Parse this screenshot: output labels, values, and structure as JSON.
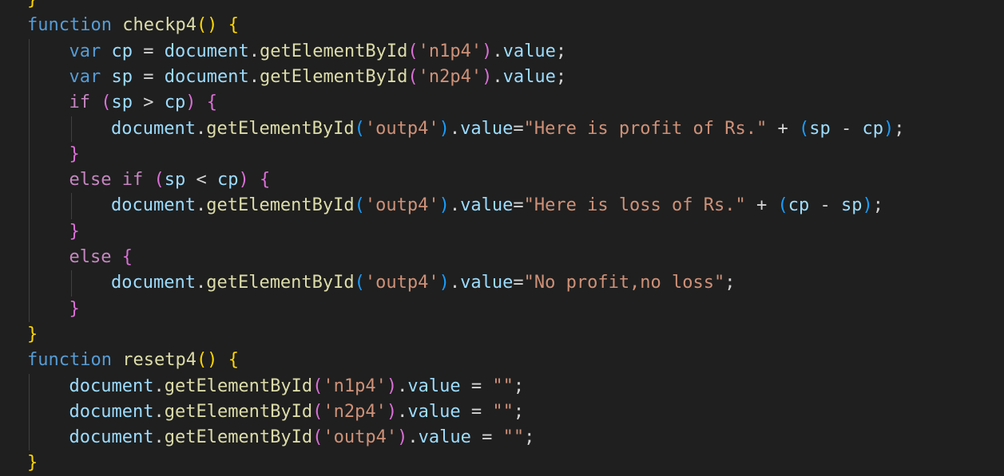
{
  "editor": {
    "background": "#1f1f1f",
    "theme_colors": {
      "keyword": "#569cd6",
      "control": "#c586c0",
      "function": "#dcdcaa",
      "variable": "#9cdcfe",
      "string": "#ce9178",
      "operator": "#d4d4d4",
      "bracket_level_1": "#ffd700",
      "bracket_level_2": "#da70d6",
      "bracket_level_3": "#179fff"
    },
    "lines": [
      {
        "indent": 0,
        "tokens": [
          [
            "b1",
            "}"
          ]
        ]
      },
      {
        "indent": 0,
        "tokens": [
          [
            "kw",
            "function"
          ],
          [
            "op",
            " "
          ],
          [
            "fn",
            "checkp4"
          ],
          [
            "b1",
            "()"
          ],
          [
            "op",
            " "
          ],
          [
            "b1",
            "{"
          ]
        ]
      },
      {
        "indent": 1,
        "tokens": [
          [
            "kw",
            "var"
          ],
          [
            "op",
            " "
          ],
          [
            "var",
            "cp"
          ],
          [
            "op",
            " = "
          ],
          [
            "var",
            "document"
          ],
          [
            "op",
            "."
          ],
          [
            "fn",
            "getElementById"
          ],
          [
            "b2",
            "("
          ],
          [
            "str",
            "'n1p4'"
          ],
          [
            "b2",
            ")"
          ],
          [
            "op",
            "."
          ],
          [
            "var",
            "value"
          ],
          [
            "op",
            ";"
          ]
        ]
      },
      {
        "indent": 1,
        "tokens": [
          [
            "kw",
            "var"
          ],
          [
            "op",
            " "
          ],
          [
            "var",
            "sp"
          ],
          [
            "op",
            " = "
          ],
          [
            "var",
            "document"
          ],
          [
            "op",
            "."
          ],
          [
            "fn",
            "getElementById"
          ],
          [
            "b2",
            "("
          ],
          [
            "str",
            "'n2p4'"
          ],
          [
            "b2",
            ")"
          ],
          [
            "op",
            "."
          ],
          [
            "var",
            "value"
          ],
          [
            "op",
            ";"
          ]
        ]
      },
      {
        "indent": 1,
        "tokens": [
          [
            "ctl",
            "if"
          ],
          [
            "op",
            " "
          ],
          [
            "b2",
            "("
          ],
          [
            "var",
            "sp"
          ],
          [
            "op",
            " > "
          ],
          [
            "var",
            "cp"
          ],
          [
            "b2",
            ")"
          ],
          [
            "op",
            " "
          ],
          [
            "b2",
            "{"
          ]
        ]
      },
      {
        "indent": 2,
        "tokens": [
          [
            "var",
            "document"
          ],
          [
            "op",
            "."
          ],
          [
            "fn",
            "getElementById"
          ],
          [
            "b3",
            "("
          ],
          [
            "str",
            "'outp4'"
          ],
          [
            "b3",
            ")"
          ],
          [
            "op",
            "."
          ],
          [
            "var",
            "value"
          ],
          [
            "op",
            "="
          ],
          [
            "str",
            "\"Here is profit of Rs.\""
          ],
          [
            "op",
            " + "
          ],
          [
            "b3",
            "("
          ],
          [
            "var",
            "sp"
          ],
          [
            "op",
            " - "
          ],
          [
            "var",
            "cp"
          ],
          [
            "b3",
            ")"
          ],
          [
            "op",
            ";"
          ]
        ]
      },
      {
        "indent": 1,
        "tokens": [
          [
            "b2",
            "}"
          ]
        ]
      },
      {
        "indent": 1,
        "tokens": [
          [
            "ctl",
            "else"
          ],
          [
            "op",
            " "
          ],
          [
            "ctl",
            "if"
          ],
          [
            "op",
            " "
          ],
          [
            "b2",
            "("
          ],
          [
            "var",
            "sp"
          ],
          [
            "op",
            " < "
          ],
          [
            "var",
            "cp"
          ],
          [
            "b2",
            ")"
          ],
          [
            "op",
            " "
          ],
          [
            "b2",
            "{"
          ]
        ]
      },
      {
        "indent": 2,
        "tokens": [
          [
            "var",
            "document"
          ],
          [
            "op",
            "."
          ],
          [
            "fn",
            "getElementById"
          ],
          [
            "b3",
            "("
          ],
          [
            "str",
            "'outp4'"
          ],
          [
            "b3",
            ")"
          ],
          [
            "op",
            "."
          ],
          [
            "var",
            "value"
          ],
          [
            "op",
            "="
          ],
          [
            "str",
            "\"Here is loss of Rs.\""
          ],
          [
            "op",
            " + "
          ],
          [
            "b3",
            "("
          ],
          [
            "var",
            "cp"
          ],
          [
            "op",
            " - "
          ],
          [
            "var",
            "sp"
          ],
          [
            "b3",
            ")"
          ],
          [
            "op",
            ";"
          ]
        ]
      },
      {
        "indent": 1,
        "tokens": [
          [
            "b2",
            "}"
          ]
        ]
      },
      {
        "indent": 1,
        "tokens": [
          [
            "ctl",
            "else"
          ],
          [
            "op",
            " "
          ],
          [
            "b2",
            "{"
          ]
        ]
      },
      {
        "indent": 2,
        "tokens": [
          [
            "var",
            "document"
          ],
          [
            "op",
            "."
          ],
          [
            "fn",
            "getElementById"
          ],
          [
            "b3",
            "("
          ],
          [
            "str",
            "'outp4'"
          ],
          [
            "b3",
            ")"
          ],
          [
            "op",
            "."
          ],
          [
            "var",
            "value"
          ],
          [
            "op",
            "="
          ],
          [
            "str",
            "\"No profit,no loss\""
          ],
          [
            "op",
            ";"
          ]
        ]
      },
      {
        "indent": 1,
        "tokens": [
          [
            "b2",
            "}"
          ]
        ]
      },
      {
        "indent": 0,
        "tokens": [
          [
            "b1",
            "}"
          ]
        ]
      },
      {
        "indent": 0,
        "tokens": [
          [
            "kw",
            "function"
          ],
          [
            "op",
            " "
          ],
          [
            "fn",
            "resetp4"
          ],
          [
            "b1",
            "()"
          ],
          [
            "op",
            " "
          ],
          [
            "b1",
            "{"
          ]
        ]
      },
      {
        "indent": 1,
        "tokens": [
          [
            "var",
            "document"
          ],
          [
            "op",
            "."
          ],
          [
            "fn",
            "getElementById"
          ],
          [
            "b2",
            "("
          ],
          [
            "str",
            "'n1p4'"
          ],
          [
            "b2",
            ")"
          ],
          [
            "op",
            "."
          ],
          [
            "var",
            "value"
          ],
          [
            "op",
            " = "
          ],
          [
            "str",
            "\"\""
          ],
          [
            "op",
            ";"
          ]
        ]
      },
      {
        "indent": 1,
        "tokens": [
          [
            "var",
            "document"
          ],
          [
            "op",
            "."
          ],
          [
            "fn",
            "getElementById"
          ],
          [
            "b2",
            "("
          ],
          [
            "str",
            "'n2p4'"
          ],
          [
            "b2",
            ")"
          ],
          [
            "op",
            "."
          ],
          [
            "var",
            "value"
          ],
          [
            "op",
            " = "
          ],
          [
            "str",
            "\"\""
          ],
          [
            "op",
            ";"
          ]
        ]
      },
      {
        "indent": 1,
        "tokens": [
          [
            "var",
            "document"
          ],
          [
            "op",
            "."
          ],
          [
            "fn",
            "getElementById"
          ],
          [
            "b2",
            "("
          ],
          [
            "str",
            "'outp4'"
          ],
          [
            "b2",
            ")"
          ],
          [
            "op",
            "."
          ],
          [
            "var",
            "value"
          ],
          [
            "op",
            " = "
          ],
          [
            "str",
            "\"\""
          ],
          [
            "op",
            ";"
          ]
        ]
      },
      {
        "indent": 0,
        "tokens": [
          [
            "b1",
            "}"
          ]
        ]
      }
    ]
  }
}
